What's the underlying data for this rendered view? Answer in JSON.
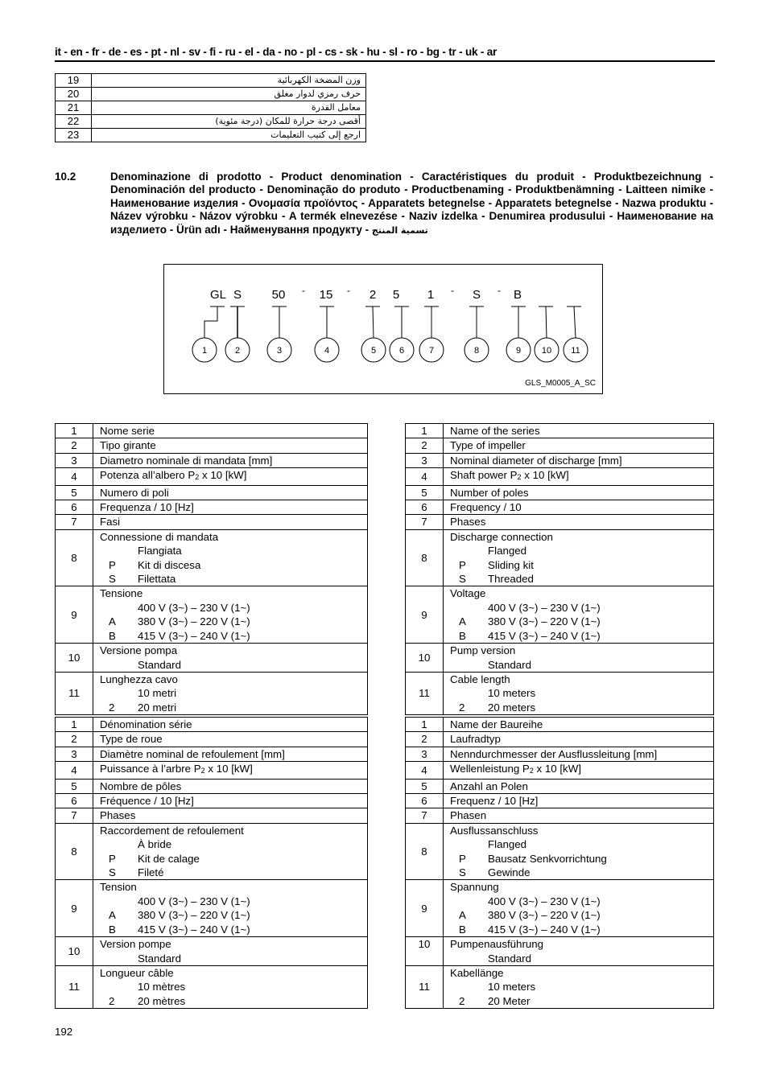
{
  "header": {
    "languages": "it - en - fr - de - es - pt - nl - sv - fi - ru  - el - da - no - pl - cs - sk - hu - sl - ro - bg - tr - uk - ar"
  },
  "arabic_table": [
    {
      "num": "19",
      "text": "وزن المضخة الكهربائية"
    },
    {
      "num": "20",
      "text": "حرف رمزي لدوار مغلق"
    },
    {
      "num": "21",
      "text": "معامل القدرة"
    },
    {
      "num": "22",
      "text": "أقصى درجة حرارة للمكان (درجة مئوية)"
    },
    {
      "num": "23",
      "text": "ارجع إلى كتيب التعليمات"
    }
  ],
  "section": {
    "number": "10.2",
    "title": "Denominazione di prodotto -  Product denomination - Caractéristiques du produit - Produktbezeichnung - Denominación del producto - Denominação do produto - Productbenaming - Produktbenämning - Laitteen nimike - Наименование изделия - Ονομασία προϊόντος - Apparatets betegnelse - Apparatets betegnelse - Nazwa produktu - Název výrobku - Názov výrobku - A termék elnevezése - Naziv izdelka - Denumirea produsului - Наименование на изделието - Ürün adı - Найменування продукту - ",
    "title_arabic": "تسمية المنتج"
  },
  "diagram": {
    "code_parts": [
      "GL",
      "S",
      "50",
      "-",
      "15",
      "-",
      "2",
      "5",
      "1",
      "-",
      "S",
      "-",
      "B"
    ],
    "callouts": [
      "1",
      "2",
      "3",
      "4",
      "5",
      "6",
      "7",
      "8",
      "9",
      "10",
      "11"
    ],
    "reference": "GLS_M0005_A_SC"
  },
  "tables": {
    "it": {
      "rows": [
        {
          "num": "1",
          "label": "Nome serie"
        },
        {
          "num": "2",
          "label": "Tipo girante"
        },
        {
          "num": "3",
          "label": "Diametro nominale di mandata [mm]"
        },
        {
          "num": "4",
          "label": "Potenza all’albero P",
          "sub": "2",
          "suffix": " x 10 [kW]"
        },
        {
          "num": "5",
          "label": "Numero di poli"
        },
        {
          "num": "6",
          "label": "Frequenza / 10 [Hz]"
        },
        {
          "num": "7",
          "label": "Fasi"
        },
        {
          "num": "8",
          "label": "Connessione di mandata",
          "options": [
            {
              "code": "",
              "text": "Flangiata"
            },
            {
              "code": "P",
              "text": "Kit di discesa"
            },
            {
              "code": "S",
              "text": "Filettata"
            }
          ]
        },
        {
          "num": "9",
          "label": "Tensione",
          "options": [
            {
              "code": "",
              "text": "400 V (3~) – 230 V (1~)"
            },
            {
              "code": "A",
              "text": "380 V (3~) – 220 V (1~)"
            },
            {
              "code": "B",
              "text": "415 V (3~) – 240 V (1~)"
            }
          ]
        },
        {
          "num": "10",
          "label": "Versione pompa",
          "options": [
            {
              "code": "",
              "text": "Standard"
            }
          ]
        },
        {
          "num": "11",
          "label": "Lunghezza cavo",
          "options": [
            {
              "code": "",
              "text": "10 metri"
            },
            {
              "code": "2",
              "text": "20 metri"
            }
          ]
        }
      ]
    },
    "en": {
      "rows": [
        {
          "num": "1",
          "label": "Name of the series"
        },
        {
          "num": "2",
          "label": "Type of impeller"
        },
        {
          "num": "3",
          "label": "Nominal diameter of discharge [mm]"
        },
        {
          "num": "4",
          "label": "Shaft power P",
          "sub": "2",
          "suffix": " x 10 [kW]"
        },
        {
          "num": "5",
          "label": "Number of poles"
        },
        {
          "num": "6",
          "label": "Frequency / 10"
        },
        {
          "num": "7",
          "label": "Phases"
        },
        {
          "num": "8",
          "label": "Discharge connection",
          "options": [
            {
              "code": "",
              "text": "Flanged"
            },
            {
              "code": "P",
              "text": "Sliding kit"
            },
            {
              "code": "S",
              "text": "Threaded"
            }
          ]
        },
        {
          "num": "9",
          "label": "Voltage",
          "options": [
            {
              "code": "",
              "text": "400 V (3~) – 230 V (1~)"
            },
            {
              "code": "A",
              "text": "380 V (3~) – 220 V (1~)"
            },
            {
              "code": "B",
              "text": "415 V (3~) – 240 V (1~)"
            }
          ]
        },
        {
          "num": "10",
          "label": "Pump version",
          "options": [
            {
              "code": "",
              "text": "Standard"
            }
          ]
        },
        {
          "num": "11",
          "label": "Cable length",
          "options": [
            {
              "code": "",
              "text": "10 meters"
            },
            {
              "code": "2",
              "text": "20 meters"
            }
          ]
        }
      ]
    },
    "fr": {
      "rows": [
        {
          "num": "1",
          "label": "Dénomination série"
        },
        {
          "num": "2",
          "label": "Type de roue"
        },
        {
          "num": "3",
          "label": "Diamètre nominal de refoulement [mm]"
        },
        {
          "num": "4",
          "label": "Puissance à l’arbre P",
          "sub": "2",
          "suffix": " x 10 [kW]"
        },
        {
          "num": "5",
          "label": "Nombre de pôles"
        },
        {
          "num": "6",
          "label": "Fréquence / 10 [Hz]"
        },
        {
          "num": "7",
          "label": "Phases"
        },
        {
          "num": "8",
          "label": "Raccordement de refoulement",
          "options": [
            {
              "code": "",
              "text": "À bride"
            },
            {
              "code": "P",
              "text": "Kit de calage"
            },
            {
              "code": "S",
              "text": "Fileté"
            }
          ]
        },
        {
          "num": "9",
          "label": "Tension",
          "options": [
            {
              "code": "",
              "text": "400 V (3~) – 230 V (1~)"
            },
            {
              "code": "A",
              "text": "380 V (3~) – 220 V (1~)"
            },
            {
              "code": "B",
              "text": "415 V (3~) – 240 V (1~)"
            }
          ]
        },
        {
          "num": "10",
          "label": "Version pompe",
          "options": [
            {
              "code": "",
              "text": "Standard"
            }
          ]
        },
        {
          "num": "11",
          "label": "Longueur câble",
          "options": [
            {
              "code": "",
              "text": "10 mètres"
            },
            {
              "code": "2",
              "text": "20 mètres"
            }
          ]
        }
      ]
    },
    "de": {
      "rows": [
        {
          "num": "1",
          "label": "Name der Baureihe"
        },
        {
          "num": "2",
          "label": "Laufradtyp"
        },
        {
          "num": "3",
          "label": "Nenndurchmesser der Ausflussleitung [mm]"
        },
        {
          "num": "4",
          "label": "Wellenleistung P",
          "sub": "2",
          "suffix": " x 10 [kW]"
        },
        {
          "num": "5",
          "label": "Anzahl an Polen"
        },
        {
          "num": "6",
          "label": "Frequenz / 10 [Hz]"
        },
        {
          "num": "7",
          "label": "Phasen"
        },
        {
          "num": "8",
          "label": "Ausflussanschluss",
          "options": [
            {
              "code": "",
              "text": "Flanged"
            },
            {
              "code": "P",
              "text": "Bausatz Senkvorrichtung"
            },
            {
              "code": "S",
              "text": "Gewinde"
            }
          ]
        },
        {
          "num": "9",
          "label": "Spannung",
          "options": [
            {
              "code": "",
              "text": "400 V (3~) – 230 V (1~)"
            },
            {
              "code": "A",
              "text": "380 V (3~) – 220 V (1~)"
            },
            {
              "code": "B",
              "text": "415 V (3~) – 240 V (1~)"
            }
          ]
        },
        {
          "num": "10",
          "label": "Pumpenausführung",
          "options": [
            {
              "code": "",
              "text": "Standard"
            }
          ],
          "num_top": true
        },
        {
          "num": "11",
          "label": "Kabellänge",
          "options": [
            {
              "code": "",
              "text": "10 meters"
            },
            {
              "code": "2",
              "text": "20 Meter"
            }
          ]
        }
      ]
    }
  },
  "footer": {
    "page_number": "192"
  }
}
